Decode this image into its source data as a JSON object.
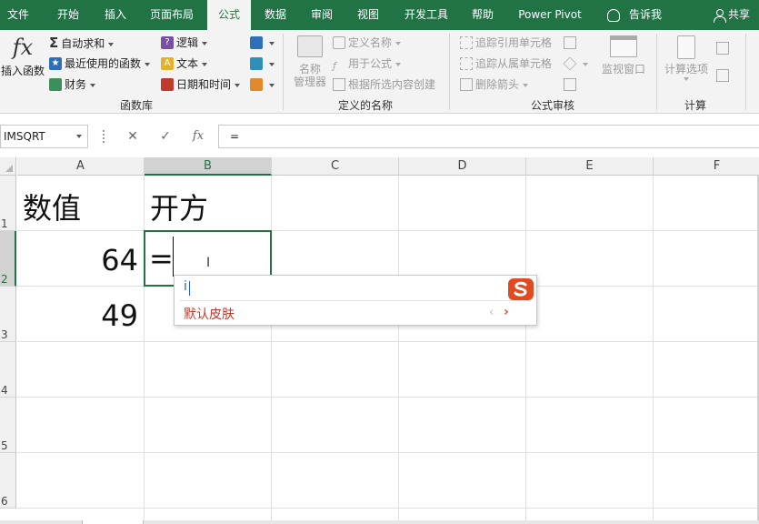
{
  "tabs": [
    {
      "id": "file",
      "label": "文件"
    },
    {
      "id": "home",
      "label": "开始"
    },
    {
      "id": "insert",
      "label": "插入"
    },
    {
      "id": "layout",
      "label": "页面布局"
    },
    {
      "id": "formulas",
      "label": "公式"
    },
    {
      "id": "data",
      "label": "数据"
    },
    {
      "id": "review",
      "label": "审阅"
    },
    {
      "id": "view",
      "label": "视图"
    },
    {
      "id": "developer",
      "label": "开发工具"
    },
    {
      "id": "help",
      "label": "帮助"
    },
    {
      "id": "powerpivot",
      "label": "Power Pivot"
    }
  ],
  "active_tab": "公式",
  "tell_me": "告诉我",
  "share": "共享",
  "ribbon": {
    "function_library": {
      "group_label": "函数库",
      "insert_function": "插入函数",
      "autosum": "自动求和",
      "recently_used": "最近使用的函数",
      "financial": "财务",
      "logical": "逻辑",
      "text": "文本",
      "datetime": "日期和时间"
    },
    "defined_names": {
      "group_label": "定义的名称",
      "name_manager_line1": "名称",
      "name_manager_line2": "管理器",
      "define_name": "定义名称",
      "use_in_formula": "用于公式",
      "create_from_selection": "根据所选内容创建"
    },
    "formula_auditing": {
      "group_label": "公式审核",
      "trace_precedents": "追踪引用单元格",
      "trace_dependents": "追踪从属单元格",
      "remove_arrows": "删除箭头",
      "watch_window": "监视窗口"
    },
    "calculation": {
      "group_label": "计算",
      "calc_options": "计算选项"
    }
  },
  "formula_bar": {
    "name_box": "IMSQRT",
    "cancel_symbol": "✕",
    "enter_symbol": "✓",
    "fx_symbol": "fx",
    "content": "="
  },
  "columns": [
    "A",
    "B",
    "C",
    "D",
    "E",
    "F"
  ],
  "rows": [
    "1",
    "2",
    "3",
    "4",
    "5",
    "6"
  ],
  "cells": {
    "A1": "数值",
    "B1": "开方",
    "A2": "64",
    "B2": "=",
    "A3": "49"
  },
  "ime": {
    "input": "i",
    "skin_label": "默认皮肤",
    "prev_symbol": "‹",
    "next_symbol": "›"
  },
  "colors": {
    "accent": "#217346",
    "ime_brand": "#e24a1f"
  }
}
